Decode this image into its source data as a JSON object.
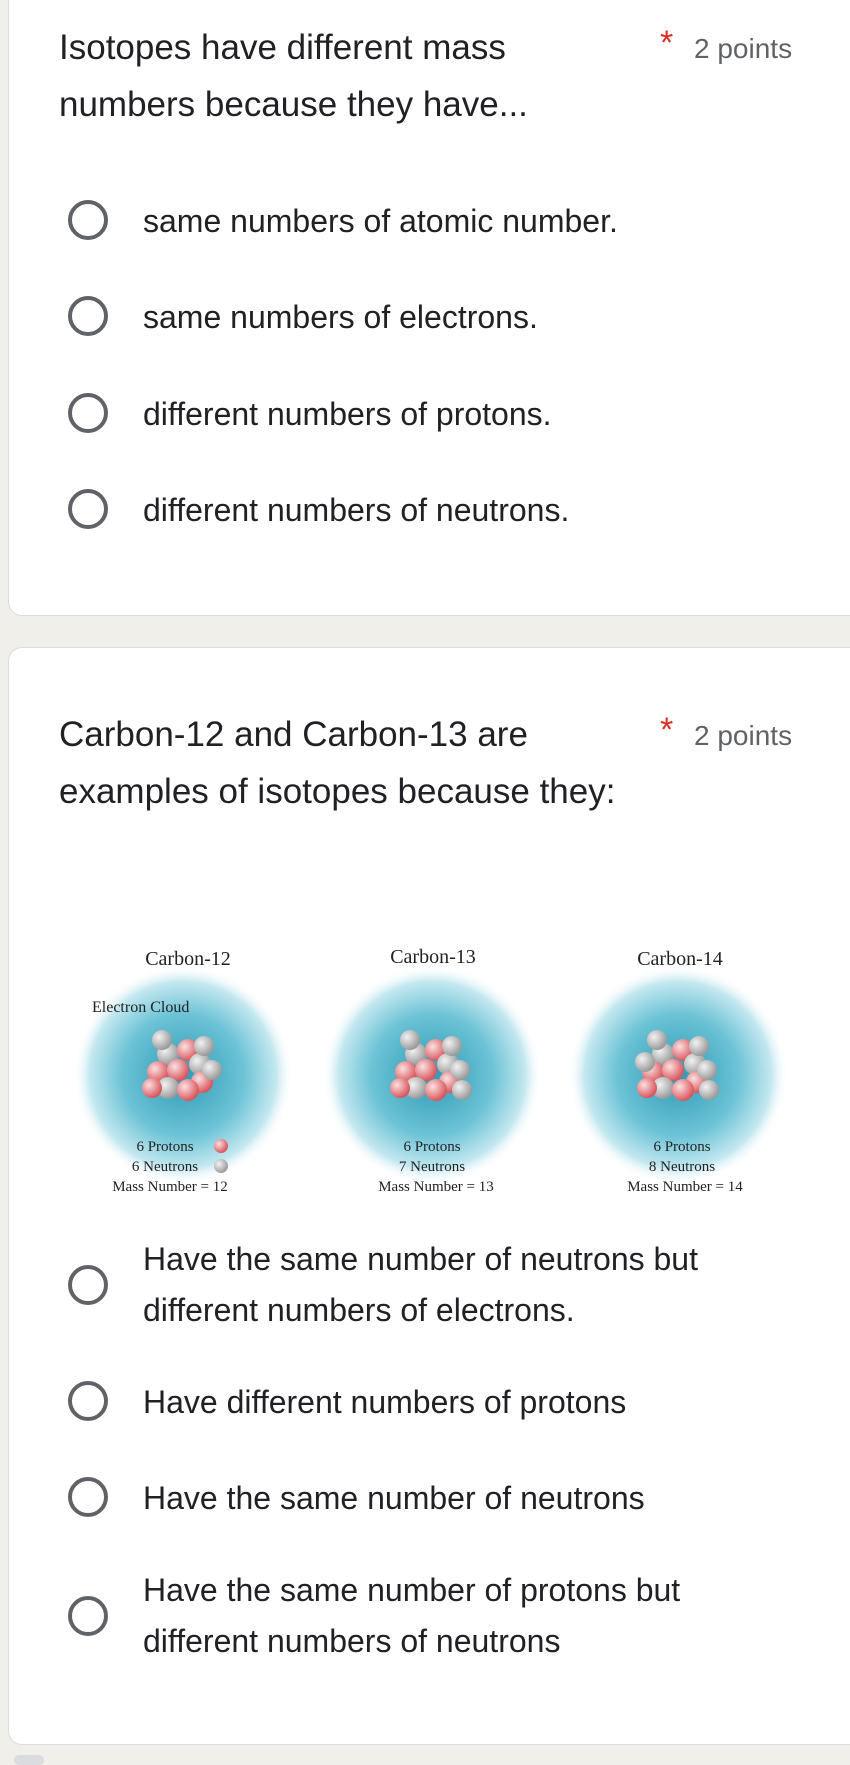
{
  "questions": [
    {
      "title": "Isotopes have different mass numbers because they have...",
      "required_mark": "*",
      "points": "2 points",
      "options": [
        "same numbers of atomic number.",
        "same numbers of electrons.",
        "different numbers of protons.",
        "different numbers of neutrons."
      ]
    },
    {
      "title": "Carbon-12 and Carbon-13 are examples of isotopes because they:",
      "required_mark": "*",
      "points": "2 points",
      "figure": {
        "electron_cloud_label": "Electron Cloud",
        "atoms": [
          {
            "name": "Carbon-12",
            "protons": "6 Protons",
            "neutrons": "6 Neutrons",
            "mass": "Mass Number = 12"
          },
          {
            "name": "Carbon-13",
            "protons": "6 Protons",
            "neutrons": "7 Neutrons",
            "mass": "Mass Number = 13"
          },
          {
            "name": "Carbon-14",
            "protons": "6 Protons",
            "neutrons": "8 Neutrons",
            "mass": "Mass Number = 14"
          }
        ]
      },
      "options": [
        "Have the same number of neutrons but different numbers of electrons.",
        "Have different numbers of protons",
        "Have the same number of neutrons",
        "Have the same number of protons but different numbers of neutrons"
      ]
    }
  ],
  "colors": {
    "accent_required": "#d93025",
    "radio_border": "#5f6368",
    "cloud": "#4fb3c9"
  }
}
